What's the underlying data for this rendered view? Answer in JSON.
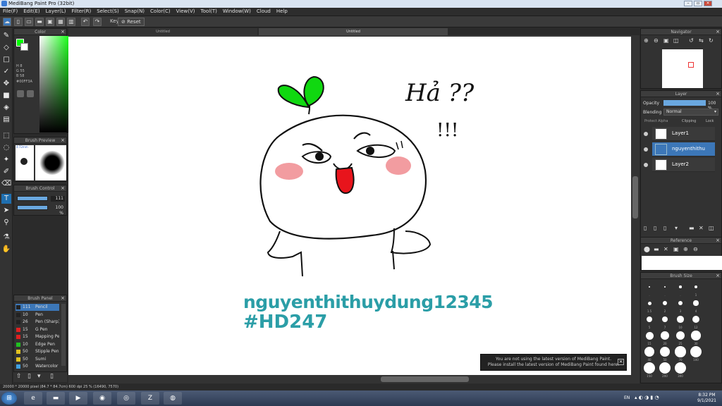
{
  "app": {
    "title": "MediBang Paint Pro (32bit)"
  },
  "menu": [
    "File(F)",
    "Edit(E)",
    "Layer(L)",
    "Filter(R)",
    "Select(S)",
    "Snap(N)",
    "Color(C)",
    "View(V)",
    "Tool(T)",
    "Window(W)",
    "Cloud",
    "Help"
  ],
  "toolbar": {
    "key_label": "Key",
    "reset_label": "Reset"
  },
  "tabs": [
    "Untitled",
    "Untitled"
  ],
  "color_panel": {
    "title": "Color",
    "h": "H 8",
    "s": "G 55",
    "b": "B 58",
    "hex": "#00FF3A",
    "fg_color": "#00ff00"
  },
  "brush_preview": {
    "title": "Brush Preview",
    "size_label": "4.72mm"
  },
  "brush_control": {
    "title": "Brush Control",
    "size": "111",
    "opacity": "100 %"
  },
  "brush_panel": {
    "title": "Brush Panel",
    "items": [
      {
        "size": "111",
        "name": "Pencil",
        "color": "#222222"
      },
      {
        "size": "10",
        "name": "Pen",
        "color": "#222222"
      },
      {
        "size": "26",
        "name": "Pen (Sharp)",
        "color": "#222222"
      },
      {
        "size": "15",
        "name": "G Pen",
        "color": "#e02020"
      },
      {
        "size": "15",
        "name": "Mapping Pen",
        "color": "#e02020"
      },
      {
        "size": "10",
        "name": "Edge Pen",
        "color": "#20c020"
      },
      {
        "size": "50",
        "name": "Stipple Pen",
        "color": "#e0c020"
      },
      {
        "size": "50",
        "name": "Sumi",
        "color": "#e0c020"
      },
      {
        "size": "50",
        "name": "Watercolor",
        "color": "#40a0e0"
      }
    ]
  },
  "canvas": {
    "text_ha": "Hả ??",
    "text_excl": "!!!",
    "signature_line1": "nguyenthithuydung12345",
    "signature_line2": "#HD247",
    "notice_line1": "You are not using the latest version of MediBang Paint.",
    "notice_line2": "Please install the latest version of MediBang Paint found here."
  },
  "navigator": {
    "title": "Navigator"
  },
  "layer_panel": {
    "title": "Layer",
    "opacity_label": "Opacity",
    "opacity_value": "100 %",
    "blending_label": "Blending",
    "blending_value": "Normal",
    "protect_alpha": "Protect Alpha",
    "clipping": "Clipping",
    "lock": "Lock",
    "layers": [
      "Layer1",
      "nguyenthithu",
      "Layer2"
    ]
  },
  "reference": {
    "title": "Reference"
  },
  "brush_size": {
    "title": "Brush Size",
    "labels": [
      ".",
      ".",
      ".",
      "1",
      "1.5",
      "2",
      "3",
      "4",
      "5",
      "7",
      "10",
      "12",
      "15",
      "20",
      "25",
      "30",
      "40",
      "50",
      "70",
      "100",
      "150",
      "200",
      "300"
    ]
  },
  "status": {
    "text": "20000 * 20000 pixel (84.7 * 84.7cm) 600 dpi 25 % (16490, 7570)"
  },
  "taskbar": {
    "time": "8:32 PM",
    "date": "9/1/2021",
    "lang": "EN"
  }
}
